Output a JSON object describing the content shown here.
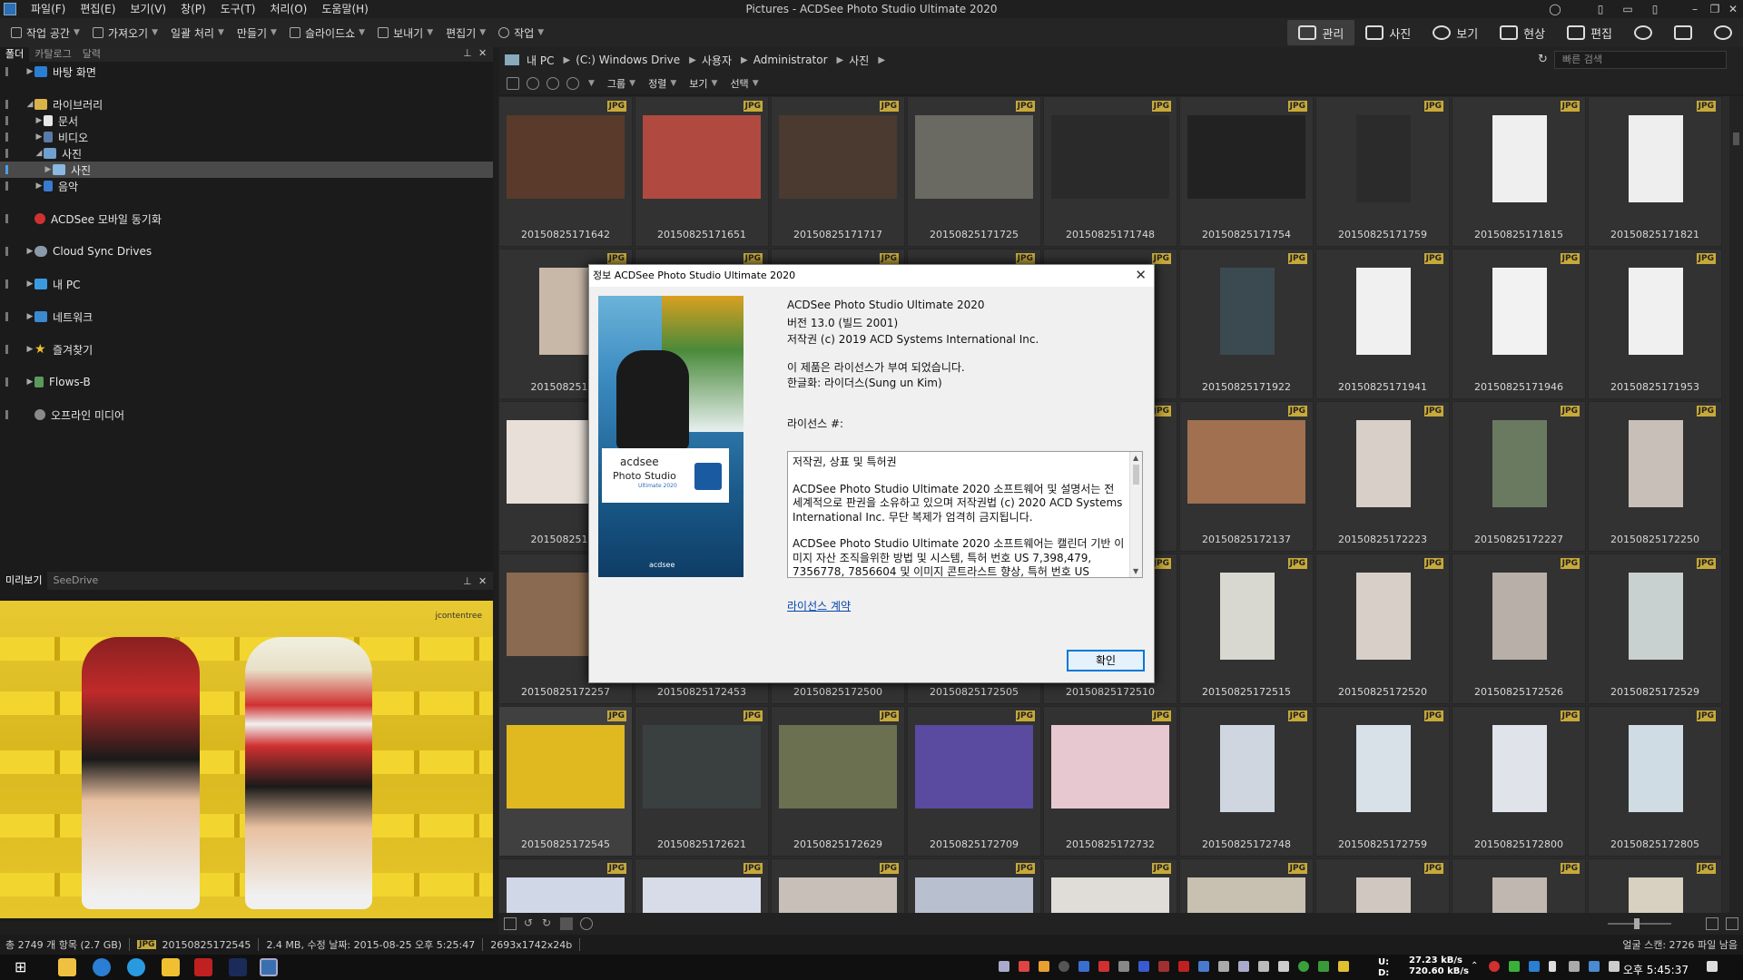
{
  "window": {
    "title": "Pictures - ACDSee Photo Studio Ultimate 2020"
  },
  "menu": [
    "파일(F)",
    "편집(E)",
    "보기(V)",
    "창(P)",
    "도구(T)",
    "처리(O)",
    "도움말(H)"
  ],
  "toolbar": [
    "작업 공간",
    "가져오기",
    "일괄 처리",
    "만들기",
    "슬라이드쇼",
    "보내기",
    "편집기",
    "작업"
  ],
  "modes": {
    "manage": "관리",
    "photos": "사진",
    "view": "보기",
    "develop": "현상",
    "edit": "편집"
  },
  "folder_panel": {
    "tabs": [
      "폴더",
      "카탈로그",
      "달력"
    ],
    "tree": [
      {
        "label": "바탕 화면"
      },
      {
        "label": "라이브러리"
      },
      {
        "label": "문서"
      },
      {
        "label": "비디오"
      },
      {
        "label": "사진"
      },
      {
        "label": "사진"
      },
      {
        "label": "음악"
      },
      {
        "label": "ACDSee 모바일 동기화"
      },
      {
        "label": "Cloud Sync Drives"
      },
      {
        "label": "내 PC"
      },
      {
        "label": "네트워크"
      },
      {
        "label": "즐겨찾기"
      },
      {
        "label": "Flows-B"
      },
      {
        "label": "오프라인 미디어"
      }
    ]
  },
  "preview_panel": {
    "tabs": [
      "미리보기",
      "SeeDrive"
    ],
    "watermark": "jcontentree"
  },
  "path": [
    "내 PC",
    "(C:) Windows Drive",
    "사용자",
    "Administrator",
    "사진"
  ],
  "search": {
    "placeholder": "빠른 검색"
  },
  "browse_toolbar": [
    "그룹",
    "정렬",
    "보기",
    "선택"
  ],
  "thumbnails": [
    {
      "name": "20150825171642",
      "badge": "JPG"
    },
    {
      "name": "20150825171651",
      "badge": "JPG"
    },
    {
      "name": "20150825171717",
      "badge": "JPG"
    },
    {
      "name": "20150825171725",
      "badge": "JPG"
    },
    {
      "name": "20150825171748",
      "badge": "JPG"
    },
    {
      "name": "20150825171754",
      "badge": "JPG"
    },
    {
      "name": "20150825171759",
      "badge": "JPG"
    },
    {
      "name": "20150825171815",
      "badge": "JPG"
    },
    {
      "name": "20150825171821",
      "badge": "JPG"
    },
    {
      "name": "20150825171",
      "badge": "JPG"
    },
    {
      "name": "",
      "badge": "JPG"
    },
    {
      "name": "",
      "badge": "JPG"
    },
    {
      "name": "",
      "badge": "JPG"
    },
    {
      "name": "",
      "badge": "JPG"
    },
    {
      "name": "20150825171922",
      "badge": "JPG"
    },
    {
      "name": "20150825171941",
      "badge": "JPG"
    },
    {
      "name": "20150825171946",
      "badge": "JPG"
    },
    {
      "name": "20150825171953",
      "badge": "JPG"
    },
    {
      "name": "20150825172",
      "badge": "JPG"
    },
    {
      "name": "",
      "badge": "JPG"
    },
    {
      "name": "",
      "badge": "JPG"
    },
    {
      "name": "",
      "badge": "JPG"
    },
    {
      "name": "",
      "badge": "JPG"
    },
    {
      "name": "20150825172137",
      "badge": "JPG"
    },
    {
      "name": "20150825172223",
      "badge": "JPG"
    },
    {
      "name": "20150825172227",
      "badge": "JPG"
    },
    {
      "name": "20150825172250",
      "badge": "JPG"
    },
    {
      "name": "20150825172257",
      "badge": "JPG"
    },
    {
      "name": "20150825172453",
      "badge": "JPG"
    },
    {
      "name": "20150825172500",
      "badge": "JPG"
    },
    {
      "name": "20150825172505",
      "badge": "JPG"
    },
    {
      "name": "20150825172510",
      "badge": "JPG"
    },
    {
      "name": "20150825172515",
      "badge": "JPG"
    },
    {
      "name": "20150825172520",
      "badge": "JPG"
    },
    {
      "name": "20150825172526",
      "badge": "JPG"
    },
    {
      "name": "20150825172529",
      "badge": "JPG"
    },
    {
      "name": "20150825172545",
      "badge": "JPG"
    },
    {
      "name": "20150825172621",
      "badge": "JPG"
    },
    {
      "name": "20150825172629",
      "badge": "JPG"
    },
    {
      "name": "20150825172709",
      "badge": "JPG"
    },
    {
      "name": "20150825172732",
      "badge": "JPG"
    },
    {
      "name": "20150825172748",
      "badge": "JPG"
    },
    {
      "name": "20150825172759",
      "badge": "JPG"
    },
    {
      "name": "20150825172800",
      "badge": "JPG"
    },
    {
      "name": "20150825172805",
      "badge": "JPG"
    },
    {
      "name": "",
      "badge": "JPG"
    },
    {
      "name": "",
      "badge": "JPG"
    },
    {
      "name": "",
      "badge": "JPG"
    },
    {
      "name": "",
      "badge": "JPG"
    },
    {
      "name": "",
      "badge": "JPG"
    },
    {
      "name": "",
      "badge": "JPG"
    },
    {
      "name": "",
      "badge": "JPG"
    },
    {
      "name": "",
      "badge": "JPG"
    },
    {
      "name": "",
      "badge": "JPG"
    }
  ],
  "thumb_colors": [
    "#5a3a2a",
    "#b04a40",
    "#4a3a30",
    "#6a6a62",
    "#2a2a2a",
    "#222",
    "#2b2b2b",
    "#efefef",
    "#eeeeee",
    "#c8b8a8",
    "",
    "",
    "",
    "",
    "#3a4a50",
    "#f0f0f0",
    "#f2f2f2",
    "#f0f0f0",
    "#e8e0d8",
    "",
    "",
    "",
    "",
    "#a07050",
    "#d8d0c8",
    "#6a7a60",
    "#c8c0b8",
    "#8a6a50",
    "",
    "",
    "",
    "",
    "#d8d8d0",
    "#d8d0c8",
    "#b8b0a8",
    "#c8d0d0",
    "#e0b820",
    "#3a4040",
    "#6a7050",
    "#5a4aa0",
    "#e8c8d0",
    "#cfd6e0",
    "#d8e0e8",
    "#e0e4ea",
    "#d0dce4",
    "#d0d8e8",
    "#d8dce8",
    "#c8c0b8",
    "#b8c0d0",
    "#e0dcd8",
    "#c8c0b0",
    "#d0c8c0",
    "#c0b8b0",
    "#d8d0c0"
  ],
  "dialog": {
    "title": "정보 ACDSee Photo Studio Ultimate 2020",
    "product": "ACDSee Photo Studio Ultimate 2020",
    "version": "버전 13.0 (빌드 2001)",
    "copyright": "저작권 (c) 2019 ACD Systems International Inc.",
    "licensed": "이 제품은 라이선스가 부여 되었습니다.",
    "localization": "한글화: 라이더스(Sung un Kim)",
    "license_no_label": "라이선스 #:",
    "license_text_heading": "저작권, 상표 및 특허권",
    "license_text_p1": "ACDSee Photo Studio Ultimate 2020 소프트웨어 및 설명서는 전 세계적으로 판권을 소유하고 있으며 저작권법 (c) 2020 ACD Systems International Inc. 무단 복제가 엄격히 금지됩니다.",
    "license_text_p2": "ACDSee Photo Studio Ultimate 2020 소프트웨어는 캘린더 기반 이미지 자산 조직을위한 방법 및 시스템, 특허 번호 US 7,398,479, 7356778, 7856604 및 이미지 콘트라스트 향상, 특허 번호 US",
    "license_link": "라이선스 계약",
    "ok": "확인",
    "logo_brand": "acdsee",
    "logo_product": "Photo Studio",
    "logo_edition": "Ultimate 2020",
    "footer_brand": "acdsee"
  },
  "status": {
    "total": "총 2749 개 항목  (2.7 GB)",
    "type": "JPG",
    "filename": "20150825172545",
    "info": "2.4 MB, 수정 날짜: 2015-08-25 오후 5:25:47",
    "dimensions": "2693x1742x24b",
    "face_scan": "얼굴 스캔: 2726 파일 남음"
  },
  "taskbar": {
    "time": "오후 5:45:37",
    "upload_label": "U:",
    "download_label": "D:",
    "upload": "27.23 kB/s",
    "download": "720.60 kB/s"
  }
}
